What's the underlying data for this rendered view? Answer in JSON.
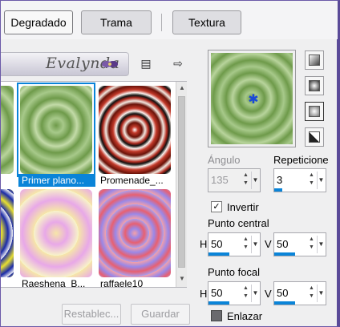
{
  "tabs": [
    {
      "label": "Degradado",
      "active": true
    },
    {
      "label": "Trama",
      "active": false
    },
    {
      "label": "Textura",
      "active": false
    }
  ],
  "presets": {
    "logo_text": "Evalynda",
    "items": [
      {
        "caption": "",
        "partial": true
      },
      {
        "caption": "Primer plano...",
        "selected": true
      },
      {
        "caption": "Promenade_..."
      },
      {
        "caption": "ol",
        "partial": true
      },
      {
        "caption": "Raeshena_B..."
      },
      {
        "caption": "raffaele10"
      }
    ]
  },
  "buttons": {
    "reset": "Restablec...",
    "save": "Guardar"
  },
  "options": {
    "angle_label": "Ángulo",
    "angle_value": "135",
    "repeats_label": "Repeticione",
    "repeats_value": "3",
    "invert_label": "Invertir",
    "invert_checked": true,
    "center_label": "Punto central",
    "center_h_label": "H",
    "center_h": "50",
    "center_v_label": "V",
    "center_v": "50",
    "focal_label": "Punto focal",
    "focal_h_label": "H",
    "focal_h": "50",
    "focal_v_label": "V",
    "focal_v": "50",
    "link_label": "Enlazar",
    "link_checked": false
  },
  "colors": {
    "accent": "#0a84d8",
    "green_dark": "#6e9a4a",
    "green_light": "#b8d49c"
  }
}
